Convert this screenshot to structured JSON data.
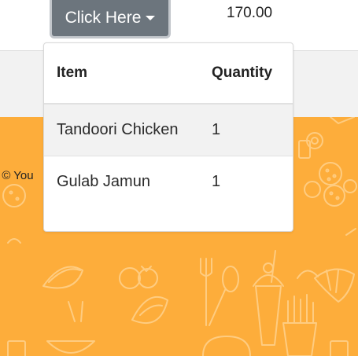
{
  "dropdown": {
    "button_label": "Click Here"
  },
  "summary": {
    "price": "170.00"
  },
  "footer": {
    "copyright_fragment": "t © You"
  },
  "menu_table": {
    "headers": [
      "Item",
      "Quantity"
    ],
    "rows": [
      {
        "item": "Tandoori Chicken",
        "quantity": "1"
      },
      {
        "item": "Gulab Jamun",
        "quantity": "1"
      }
    ]
  },
  "colors": {
    "button_bg": "#6c757d",
    "footer_bg": "#fdad3b",
    "band_bg": "#f2f2f2"
  },
  "icons": [
    "caret-down-icon",
    "food-doodle-pattern"
  ]
}
